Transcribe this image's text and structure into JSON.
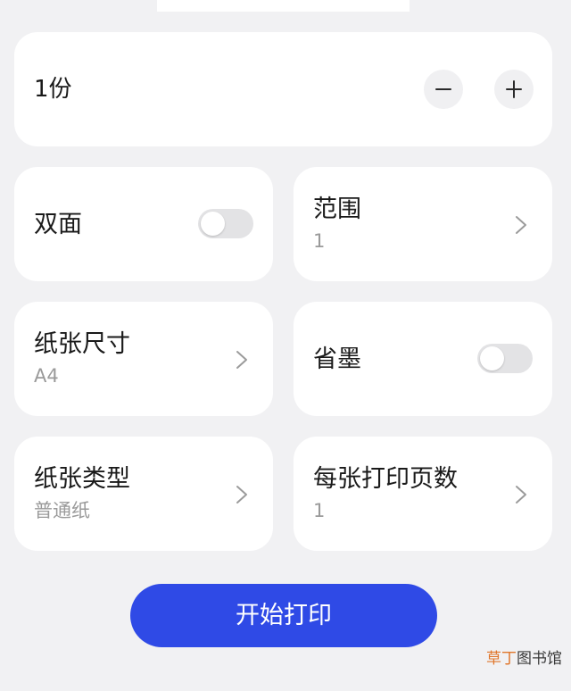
{
  "copies": {
    "label": "1份",
    "decrease_icon": "minus-icon",
    "increase_icon": "plus-icon"
  },
  "options": {
    "duplex": {
      "title": "双面",
      "enabled": false
    },
    "range": {
      "title": "范围",
      "value": "1"
    },
    "paper_size": {
      "title": "纸张尺寸",
      "value": "A4"
    },
    "ink_saving": {
      "title": "省墨",
      "enabled": false
    },
    "paper_type": {
      "title": "纸张类型",
      "value": "普通纸"
    },
    "pages_per_sheet": {
      "title": "每张打印页数",
      "value": "1"
    }
  },
  "print_button": {
    "label": "开始打印"
  },
  "watermark": {
    "part1": "草丁",
    "part2": "图书馆"
  },
  "colors": {
    "background": "#f1f1f3",
    "card": "#ffffff",
    "primary_button": "#2f4ae6",
    "toggle_off": "#e3e3e5",
    "secondary_text": "#9a9a9a",
    "watermark_accent": "#e0762b"
  }
}
